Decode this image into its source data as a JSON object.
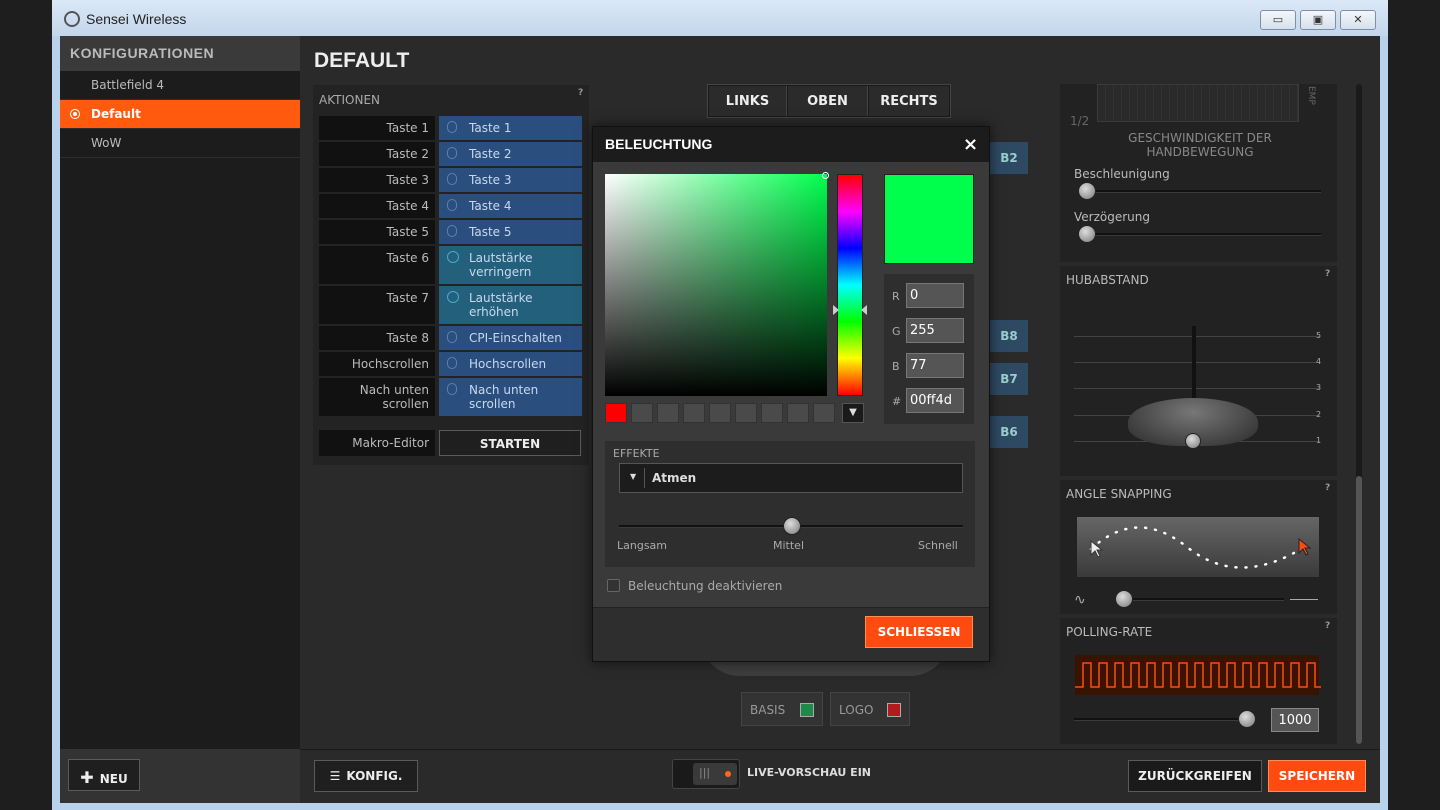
{
  "window": {
    "title": "Sensei Wireless",
    "minimize": "▭",
    "maximize": "▣",
    "close": "✕"
  },
  "sidebar": {
    "title": "KONFIGURATIONEN",
    "items": [
      {
        "label": "Battlefield 4"
      },
      {
        "label": "Default"
      },
      {
        "label": "WoW"
      }
    ],
    "new_label": "NEU"
  },
  "page_title": "DEFAULT",
  "actions": {
    "title": "AKTIONEN",
    "help": "?",
    "rows": [
      {
        "key": "Taste 1",
        "value": "Taste 1"
      },
      {
        "key": "Taste 2",
        "value": "Taste 2"
      },
      {
        "key": "Taste 3",
        "value": "Taste 3"
      },
      {
        "key": "Taste 4",
        "value": "Taste 4"
      },
      {
        "key": "Taste 5",
        "value": "Taste 5"
      },
      {
        "key": "Taste 6",
        "value": "Lautstärke verringern"
      },
      {
        "key": "Taste 7",
        "value": "Lautstärke erhöhen"
      },
      {
        "key": "Taste 8",
        "value": "CPI-Einschalten"
      },
      {
        "key": "Hochscrollen",
        "value": "Hochscrollen"
      },
      {
        "key": "Nach unten scrollen",
        "value": "Nach unten scrollen"
      }
    ],
    "macro_label": "Makro-Editor",
    "macro_button": "STARTEN"
  },
  "view_tabs": [
    "LINKS",
    "OBEN",
    "RECHTS"
  ],
  "mouse_buttons": [
    "B2",
    "B8",
    "B7",
    "B6"
  ],
  "zones": {
    "base": "BASIS",
    "logo": "LOGO"
  },
  "dialog": {
    "title": "BELEUCHTUNG",
    "close": "×",
    "rgb": {
      "r": "0",
      "g": "255",
      "b": "77",
      "hex": "00ff4d"
    },
    "labels": {
      "r": "R",
      "g": "G",
      "b": "B",
      "hex": "#"
    },
    "preview_color": "#00ff4d",
    "effects_title": "EFFEKTE",
    "effect_selected": "Atmen",
    "speed_labels": [
      "Langsam",
      "Mittel",
      "Schnell"
    ],
    "speed_level": 0.5,
    "disable_label": "Beleuchtung deaktivieren",
    "close_button": "SCHLIESSEN",
    "swatch_first": "#ff0000"
  },
  "right_panel": {
    "page_indicator": "1/2",
    "emp": "EMP",
    "speed_title": "GESCHWINDIGKEIT DER HANDBEWEGUNG",
    "accel_label": "Beschleunigung",
    "decel_label": "Verzögerung",
    "lift_title": "HUBABSTAND",
    "lift_scale": [
      "5",
      "4",
      "3",
      "2",
      "1"
    ],
    "angle_title": "ANGLE SNAPPING",
    "polling_title": "POLLING-RATE",
    "polling_value": "1000",
    "help": "?"
  },
  "bottom": {
    "konfig": "KONFIG.",
    "live_preview": "LIVE-VORSCHAU EIN",
    "revert": "ZURÜCKGREIFEN",
    "save": "SPEICHERN"
  }
}
